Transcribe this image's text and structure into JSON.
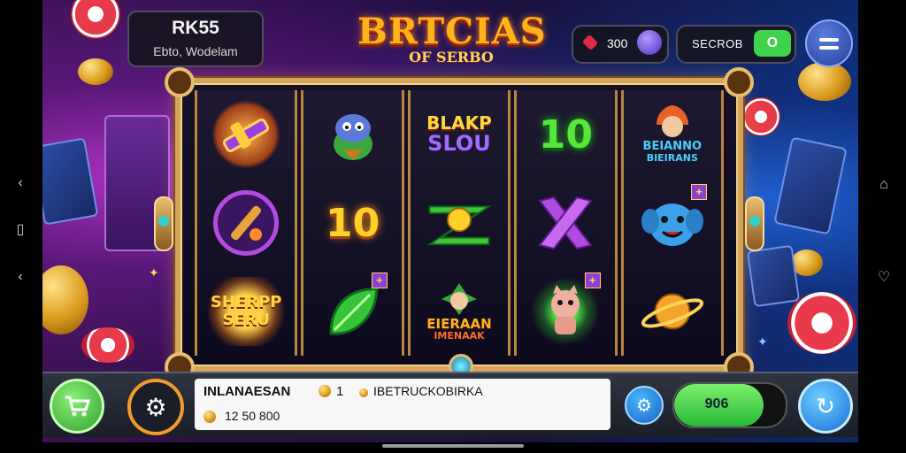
{
  "header": {
    "balance_amount": "RK55",
    "balance_label": "Ebto, Wodelam",
    "logo_title": "BRTCIAS",
    "logo_subtitle": "OF SERBO",
    "gems_value": "300",
    "secure_label": "SECROB",
    "secure_button": "O"
  },
  "reels": [
    [
      "sword-gem",
      "blue-creature-leaf",
      "gold-dragon-sherpp"
    ],
    [
      "purple-sword-shield",
      "10",
      "green-leaf-seed"
    ],
    [
      "BLAKP SLOU",
      "green-gold-coin",
      "green-elf-eierraan"
    ],
    [
      "10",
      "purple-x",
      "pink-creature"
    ],
    [
      "fairy-heiriano",
      "blue-elephant",
      "gold-planet"
    ]
  ],
  "symbols": {
    "blakp_line1": "BLAKP",
    "blakp_line2": "SLOU",
    "ten": "10",
    "sherpp_line1": "SHERPP",
    "sherpp_line2": "SERU",
    "eierraan_line1": "EIERAAN",
    "eierraan_line2": "IMENAAK",
    "heiriano_line1": "BEIANNO",
    "heiriano_line2": "BIEIRANS",
    "plus": "+"
  },
  "bottom": {
    "info_title": "INLANAESAN",
    "info_count": "1",
    "info_right": "IBETRUCKOBIRKA",
    "info_amount": "12 50 800",
    "bet_value": "906",
    "bet_fill_fraction": 0.8
  },
  "colors": {
    "accent_green": "#3fd24d",
    "frame_gold": "#d4a45a",
    "spin_blue": "#1a6ed8"
  }
}
